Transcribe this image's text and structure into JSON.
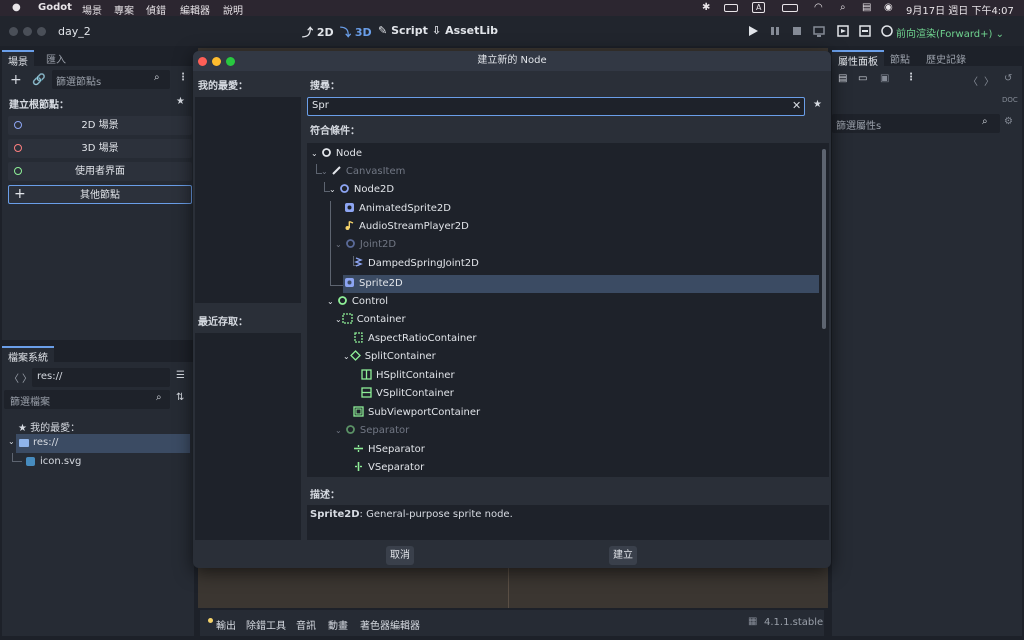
{
  "menubar": {
    "app": "Godot",
    "items": [
      "場景",
      "專案",
      "偵錯",
      "編輯器",
      "說明"
    ],
    "datetime": "9月17日 週日 下午4:07",
    "input_source": "A"
  },
  "titlebar": {
    "project": "day_2",
    "workspaces": [
      "2D",
      "3D",
      "Script",
      "AssetLib"
    ],
    "renderer": "前向渲染(Forward+)"
  },
  "scene_dock": {
    "tabs": [
      "場景",
      "匯入"
    ],
    "filter_placeholder": "篩選節點s",
    "create_root_label": "建立根節點：",
    "roots": [
      "2D 場景",
      "3D 場景",
      "使用者界面",
      "其他節點"
    ],
    "root_colors": [
      "#8da5f3",
      "#fc7f7f",
      "#8eef97",
      "#e2e5ea"
    ]
  },
  "filesystem_dock": {
    "tab": "檔案系統",
    "path": "res://",
    "filter_placeholder": "篩選檔案",
    "favorites_label": "我的最愛：",
    "tree": [
      "res://",
      "icon.svg"
    ]
  },
  "inspector_dock": {
    "tabs": [
      "屬性面板",
      "節點",
      "歷史記錄"
    ],
    "filter_placeholder": "篩選屬性s"
  },
  "bottom_panel": {
    "tabs": [
      "輸出",
      "除錯工具",
      "音訊",
      "動畫",
      "著色器編輯器"
    ],
    "version": "4.1.1.stable"
  },
  "dialog": {
    "title": "建立新的 Node",
    "favorites_label": "我的最愛：",
    "recent_label": "最近存取：",
    "search_label": "搜尋：",
    "search_value": "Spr",
    "matches_label": "符合條件：",
    "tree": [
      {
        "label": "Node",
        "dim": false,
        "selected": false,
        "icon": "node-circle-icon",
        "color": "#e2e5ea"
      },
      {
        "label": "CanvasItem",
        "dim": true,
        "selected": false,
        "icon": "pencil-icon",
        "color": "#e2e5ea"
      },
      {
        "label": "Node2D",
        "dim": false,
        "selected": false,
        "icon": "node2d-circle-icon",
        "color": "#8da5f3"
      },
      {
        "label": "AnimatedSprite2D",
        "dim": false,
        "selected": false,
        "icon": "animated-sprite-icon",
        "color": "#8da5f3"
      },
      {
        "label": "AudioStreamPlayer2D",
        "dim": false,
        "selected": false,
        "icon": "audio-note-icon",
        "color": "#f5d36b"
      },
      {
        "label": "Joint2D",
        "dim": true,
        "selected": false,
        "icon": "joint-circle-icon",
        "color": "#8da5f3"
      },
      {
        "label": "DampedSpringJoint2D",
        "dim": false,
        "selected": false,
        "icon": "spring-icon",
        "color": "#8da5f3"
      },
      {
        "label": "Sprite2D",
        "dim": false,
        "selected": true,
        "icon": "sprite-icon",
        "color": "#8da5f3"
      },
      {
        "label": "Control",
        "dim": false,
        "selected": false,
        "icon": "control-circle-icon",
        "color": "#8eef97"
      },
      {
        "label": "Container",
        "dim": false,
        "selected": false,
        "icon": "container-icon",
        "color": "#8eef97"
      },
      {
        "label": "AspectRatioContainer",
        "dim": false,
        "selected": false,
        "icon": "aspect-ratio-icon",
        "color": "#8eef97"
      },
      {
        "label": "SplitContainer",
        "dim": false,
        "selected": false,
        "icon": "split-container-icon",
        "color": "#8eef97"
      },
      {
        "label": "HSplitContainer",
        "dim": false,
        "selected": false,
        "icon": "hsplit-icon",
        "color": "#8eef97"
      },
      {
        "label": "VSplitContainer",
        "dim": false,
        "selected": false,
        "icon": "vsplit-icon",
        "color": "#8eef97"
      },
      {
        "label": "SubViewportContainer",
        "dim": false,
        "selected": false,
        "icon": "subviewport-icon",
        "color": "#8eef97"
      },
      {
        "label": "Separator",
        "dim": true,
        "selected": false,
        "icon": "separator-circle-icon",
        "color": "#8eef97"
      },
      {
        "label": "HSeparator",
        "dim": false,
        "selected": false,
        "icon": "hseparator-icon",
        "color": "#8eef97"
      },
      {
        "label": "VSeparator",
        "dim": false,
        "selected": false,
        "icon": "vseparator-icon",
        "color": "#8eef97"
      }
    ],
    "description_label": "描述：",
    "description_name": "Sprite2D",
    "description_text": ": General-purpose sprite node.",
    "cancel_label": "取消",
    "create_label": "建立"
  },
  "colors": {
    "accent": "#6a9ee8",
    "selection": "#3b4b63"
  }
}
